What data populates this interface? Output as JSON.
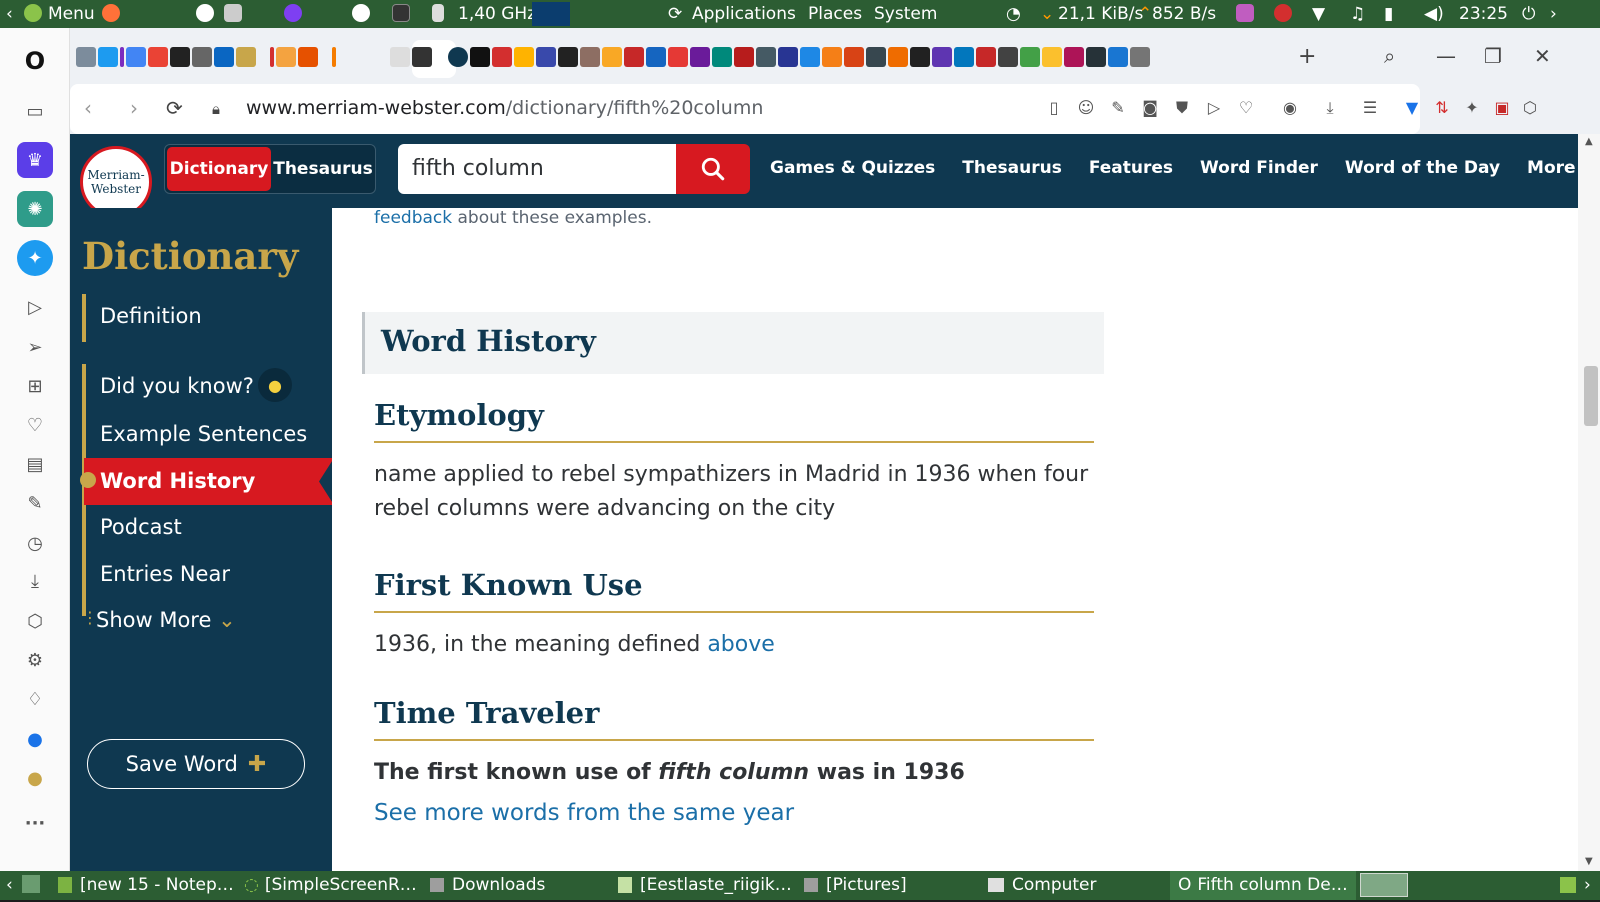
{
  "os_top": {
    "menu_label": "Menu",
    "cpu": "1,40 GHz",
    "applications": "Applications",
    "places": "Places",
    "system": "System",
    "net_down": "21,1 KiB/s",
    "net_up": "852 B/s",
    "clock": "23:25"
  },
  "browser": {
    "url_host": "www.merriam-webster.com",
    "url_path": "/dictionary/fifth%20column"
  },
  "mw": {
    "logo_line1": "Merriam-",
    "logo_line2": "Webster",
    "tab_dictionary": "Dictionary",
    "tab_thesaurus": "Thesaurus",
    "search_value": "fifth column",
    "nav": [
      "Games & Quizzes",
      "Thesaurus",
      "Features",
      "Word Finder",
      "Word of the Day",
      "More"
    ]
  },
  "leftnav": {
    "title": "Dictionary",
    "items": [
      "Definition",
      "Did you know?",
      "Example Sentences",
      "Word History",
      "Podcast",
      "Entries Near",
      "Show More"
    ],
    "active": "Word History",
    "save": "Save Word"
  },
  "content": {
    "feedback_link": "feedback",
    "feedback_rest": " about these examples.",
    "word_history": "Word History",
    "etymology_h": "Etymology",
    "etymology_text": "name applied to rebel sympathizers in Madrid in 1936 when four rebel columns were advancing on the city",
    "first_use_h": "First Known Use",
    "first_use_text": "1936, in the meaning defined ",
    "first_use_link": "above",
    "time_traveler_h": "Time Traveler",
    "tt_pre": "The first known use of ",
    "tt_word": "fifth column",
    "tt_post": " was in 1936",
    "tt_link": "See more words from the same year"
  },
  "taskbar": {
    "items": [
      "[new 15 - Notep…",
      "[SimpleScreenR…",
      "Downloads",
      "[Eestlaste_riigik…",
      "[Pictures]",
      "Computer",
      "Fifth column De…"
    ]
  },
  "colors": {
    "mw_navy": "#0f3850",
    "mw_red": "#d71920",
    "mw_gold": "#c8a64a",
    "link_blue": "#1b6fa8",
    "os_panel": "#2c5d33"
  }
}
